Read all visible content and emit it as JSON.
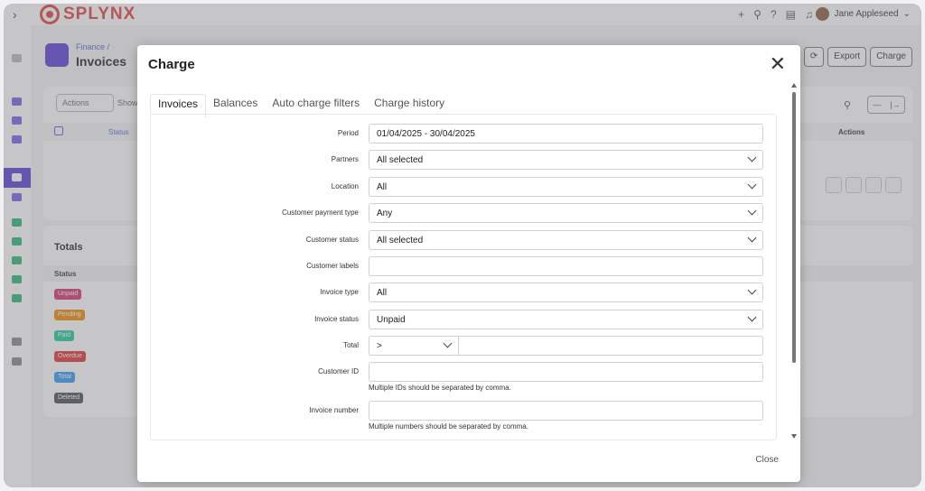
{
  "app": {
    "brand": "SPLYNX",
    "user_name": "Jane Appleseed",
    "breadcrumb": "Finance /",
    "page_title": "Invoices",
    "buttons": {
      "export": "Export",
      "charge": "Charge"
    },
    "toolbar": {
      "actions": "Actions",
      "show": "Show"
    },
    "table_headers": {
      "status": "Status",
      "actions": "Actions"
    },
    "totals": {
      "title": "Totals",
      "status_header": "Status",
      "badges": [
        {
          "label": "Unpaid",
          "color": "#d6336c"
        },
        {
          "label": "Pending",
          "color": "#f08c00"
        },
        {
          "label": "Paid",
          "color": "#20c997"
        },
        {
          "label": "Overdue",
          "color": "#e03131"
        },
        {
          "label": "Total",
          "color": "#339af0"
        },
        {
          "label": "Deleted",
          "color": "#495057"
        }
      ]
    }
  },
  "modal": {
    "title": "Charge",
    "tabs": [
      "Invoices",
      "Balances",
      "Auto charge filters",
      "Charge history"
    ],
    "fields": {
      "period": {
        "label": "Period",
        "value": "01/04/2025 - 30/04/2025"
      },
      "partners": {
        "label": "Partners",
        "value": "All selected"
      },
      "location": {
        "label": "Location",
        "value": "All"
      },
      "customer_payment_type": {
        "label": "Customer payment type",
        "value": "Any"
      },
      "customer_status": {
        "label": "Customer status",
        "value": "All selected"
      },
      "customer_labels": {
        "label": "Customer labels",
        "value": ""
      },
      "invoice_type": {
        "label": "Invoice type",
        "value": "All"
      },
      "invoice_status": {
        "label": "Invoice status",
        "value": "Unpaid"
      },
      "total": {
        "label": "Total",
        "operator": ">",
        "value": ""
      },
      "customer_id": {
        "label": "Customer ID",
        "value": "",
        "hint": "Multiple IDs should be separated by comma."
      },
      "invoice_number": {
        "label": "Invoice number",
        "value": "",
        "hint": "Multiple numbers should be separated by comma."
      }
    },
    "footer_close": "Close"
  }
}
